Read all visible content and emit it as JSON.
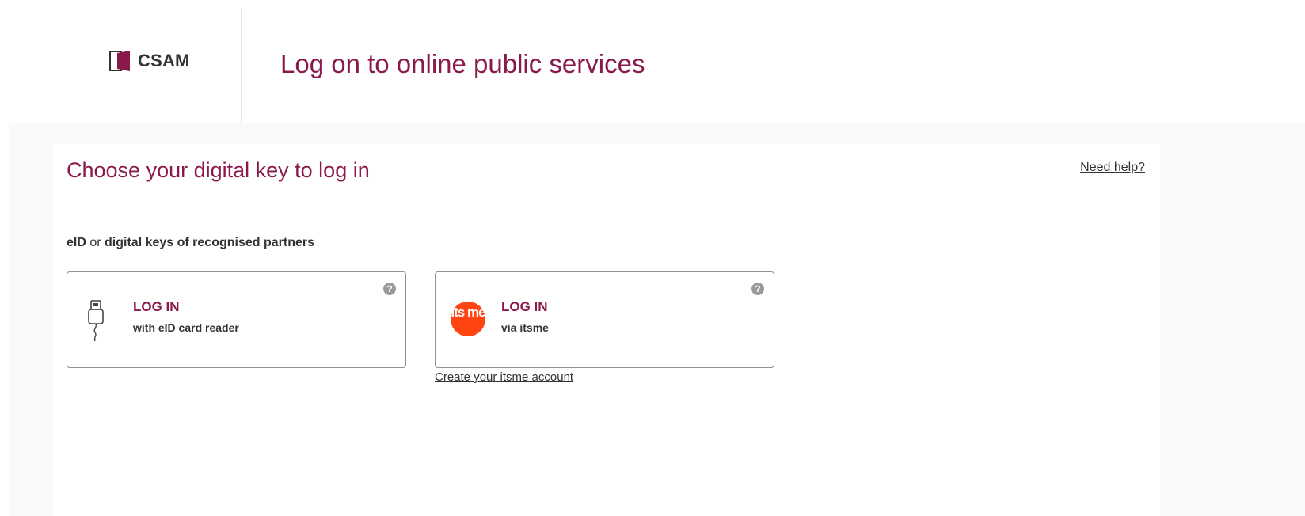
{
  "header": {
    "logo_text": "CSAM",
    "title": "Log on to online public services"
  },
  "main": {
    "title": "Choose your digital key to log in",
    "help_link": "Need help?",
    "section_label": {
      "part1": "eID",
      "connector": " or ",
      "part2": "digital keys of recognised partners"
    },
    "options": [
      {
        "title": "LOG IN",
        "subtitle": "with eID card reader",
        "help_icon": "question-circle-icon",
        "icon": "card-reader-icon"
      },
      {
        "title": "LOG IN",
        "subtitle": "via itsme",
        "help_icon": "question-circle-icon",
        "icon": "itsme-logo",
        "logo_text": "its me"
      }
    ],
    "create_account_link": "Create your itsme account"
  },
  "colors": {
    "brand": "#8a1a4b",
    "itsme": "#ff4612",
    "background": "#f8f9fa"
  }
}
